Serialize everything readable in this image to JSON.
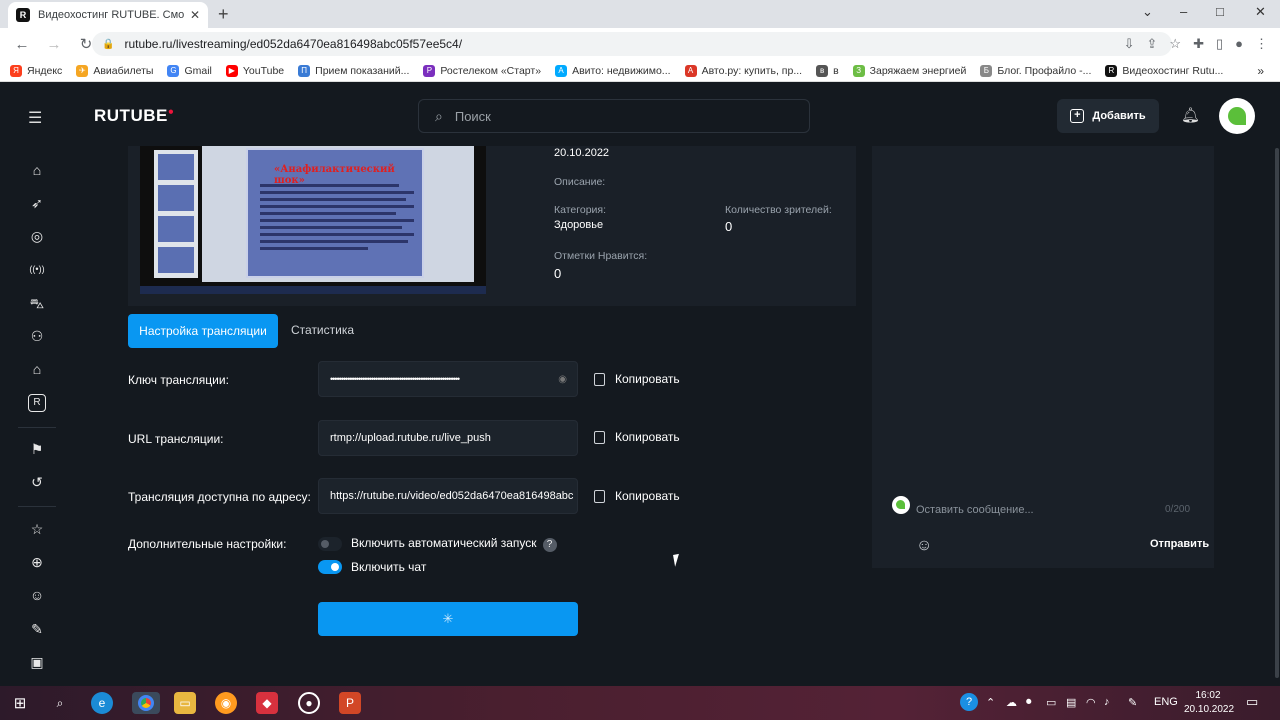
{
  "browser": {
    "tab_title": "Видеохостинг RUTUBE. Смотри",
    "url": "rutube.ru/livestreaming/ed052da6470ea816498abc05f57ee5c4/",
    "bookmarks": [
      {
        "label": "Яндекс",
        "color": "#fc3f1d",
        "glyph": "Я"
      },
      {
        "label": "Авиабилеты",
        "color": "#f5a623",
        "glyph": "✈"
      },
      {
        "label": "Gmail",
        "color": "#4285f4",
        "glyph": "G"
      },
      {
        "label": "YouTube",
        "color": "#ff0000",
        "glyph": "▶"
      },
      {
        "label": "Прием показаний...",
        "color": "#3a7bd5",
        "glyph": "П"
      },
      {
        "label": "Ростелеком «Старт»",
        "color": "#7b2fbe",
        "glyph": "Р"
      },
      {
        "label": "Авито: недвижимо...",
        "color": "#00aaff",
        "glyph": "А"
      },
      {
        "label": "Авто.ру: купить, пр...",
        "color": "#db3727",
        "glyph": "A"
      },
      {
        "label": "в",
        "color": "#555555",
        "glyph": "в"
      },
      {
        "label": "Заряжаем энергией",
        "color": "#6dbd45",
        "glyph": "З"
      },
      {
        "label": "Блог. Профайло -...",
        "color": "#888888",
        "glyph": "Б"
      },
      {
        "label": "Видеохостинг Rutu...",
        "color": "#111111",
        "glyph": "R"
      }
    ]
  },
  "header": {
    "logo": "RUTUBE",
    "search_placeholder": "Поиск",
    "add_label": "Добавить"
  },
  "stream_info": {
    "date": "20.10.2022",
    "description_label": "Описание:",
    "category_label": "Категория:",
    "category_value": "Здоровье",
    "viewers_label": "Количество зрителей:",
    "viewers_value": "0",
    "likes_label": "Отметки Нравится:",
    "likes_value": "0",
    "slide_title": "«Анафилактический шок»"
  },
  "tabs": {
    "settings": "Настройка трансляции",
    "stats": "Статистика"
  },
  "form": {
    "key_label": "Ключ трансляции:",
    "key_value": "••••••••••••••••••••••••••••••••••••••••••••••••••••••••••••",
    "url_label": "URL трансляции:",
    "url_value": "rtmp://upload.rutube.ru/live_push",
    "public_label": "Трансляция доступна по адресу:",
    "public_value": "https://rutube.ru/video/ed052da6470ea816498abc",
    "copy_label": "Копировать",
    "extra_label": "Дополнительные настройки:",
    "autostart_label": "Включить автоматический запуск",
    "autostart_on": false,
    "chat_label": "Включить чат",
    "chat_on": true
  },
  "chat": {
    "placeholder": "Оставить сообщение...",
    "counter": "0/200",
    "send_label": "Отправить"
  },
  "taskbar": {
    "lang": "ENG",
    "time": "16:02",
    "date": "20.10.2022"
  },
  "colors": {
    "accent": "#0997f2",
    "background": "#14191f",
    "panel": "#1a2028",
    "brand_dot": "#ed143b"
  }
}
